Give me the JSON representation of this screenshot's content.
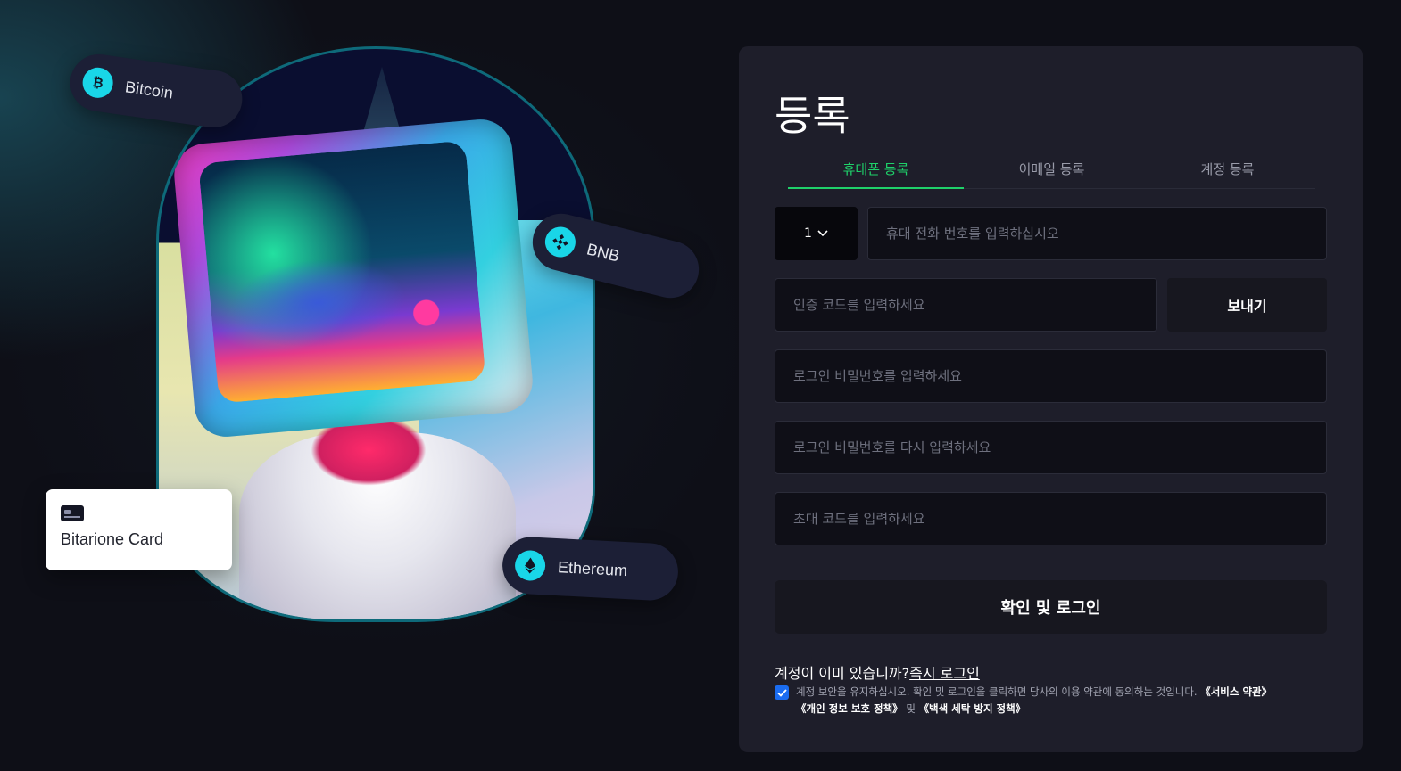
{
  "hero": {
    "coins": [
      {
        "name": "Bitcoin",
        "icon": "bitcoin-icon"
      },
      {
        "name": "BNB",
        "icon": "bnb-icon"
      },
      {
        "name": "Ethereum",
        "icon": "ethereum-icon"
      }
    ],
    "card": {
      "label": "Bitarione Card",
      "icon": "credit-card-icon"
    }
  },
  "form": {
    "title": "등록",
    "tabs": [
      {
        "label": "휴대폰 등록",
        "active": true
      },
      {
        "label": "이메일 등록",
        "active": false
      },
      {
        "label": "계정 등록",
        "active": false
      }
    ],
    "country_code": "1",
    "phone_placeholder": "휴대 전화 번호를 입력하십시오",
    "code_placeholder": "인증 코드를 입력하세요",
    "send_label": "보내기",
    "password_placeholder": "로그인 비밀번호를 입력하세요",
    "password_confirm_placeholder": "로그인 비밀번호를 다시 입력하세요",
    "invite_placeholder": "초대 코드를 입력하세요",
    "submit_label": "확인 및 로그인",
    "have_account_text": "계정이 이미 있습니까?",
    "login_link": "즉시 로그인",
    "terms": {
      "text": "계정 보안을 유지하십시오. 확인 및 로그인을 클릭하면 당사의 이용 약관에 동의하는 것입니다.",
      "service_terms": "《서비스 약관》",
      "privacy_policy": "《개인 정보 보호 정책》",
      "and": "및",
      "aml_policy": "《백색 세탁 방지 정책》",
      "checked": true
    }
  },
  "colors": {
    "accent_green": "#1fd16a",
    "checkbox_blue": "#1a6cf0",
    "panel_bg": "#1e1e2a",
    "coin_cyan": "#19d6e8"
  }
}
